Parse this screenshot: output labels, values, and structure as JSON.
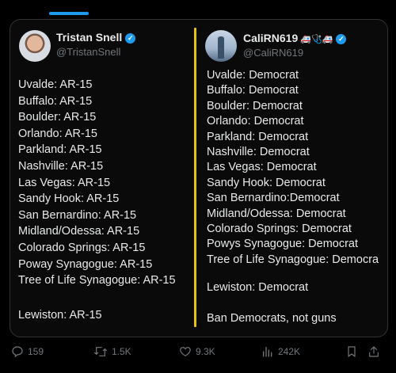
{
  "left_tweet": {
    "author_name": "Tristan Snell",
    "author_handle": "@TristanSnell",
    "lines": [
      "Uvalde: AR-15",
      "Buffalo: AR-15",
      "Boulder: AR-15",
      "Orlando: AR-15",
      "Parkland: AR-15",
      "Nashville: AR-15",
      "Las Vegas: AR-15",
      "Sandy Hook: AR-15",
      "San Bernardino: AR-15",
      "Midland/Odessa: AR-15",
      "Colorado Springs: AR-15",
      "Poway Synagogue: AR-15",
      "Tree of Life Synagogue: AR-15"
    ],
    "last_line": "Lewiston: AR-15"
  },
  "right_tweet": {
    "author_name": "CaliRN619",
    "author_emoji": "🚑🩺🚑",
    "author_handle": "@CaliRN619",
    "lines": [
      "Uvalde: Democrat",
      "Buffalo: Democrat",
      "Boulder: Democrat",
      "Orlando: Democrat",
      "Parkland: Democrat",
      "Nashville: Democrat",
      "Las Vegas: Democrat",
      "Sandy Hook: Democrat",
      "San Bernardino:Democrat",
      "Midland/Odessa: Democrat",
      "Colorado Springs: Democrat",
      "Powys Synagogue: Democrat",
      "Tree of Life Synagogue: Democra"
    ],
    "last_line": "Lewiston: Democrat",
    "closing": "Ban Democrats, not guns"
  },
  "actions": {
    "replies": "159",
    "reposts": "1.5K",
    "likes": "9.3K",
    "views": "242K"
  },
  "colors": {
    "accent": "#1d9bf0",
    "divider": "#e3c21b",
    "muted": "#71767b",
    "text": "#e7e9ea"
  },
  "icons": [
    "reply-icon",
    "repost-icon",
    "like-icon",
    "views-icon",
    "bookmark-icon",
    "share-icon",
    "verified-icon"
  ]
}
